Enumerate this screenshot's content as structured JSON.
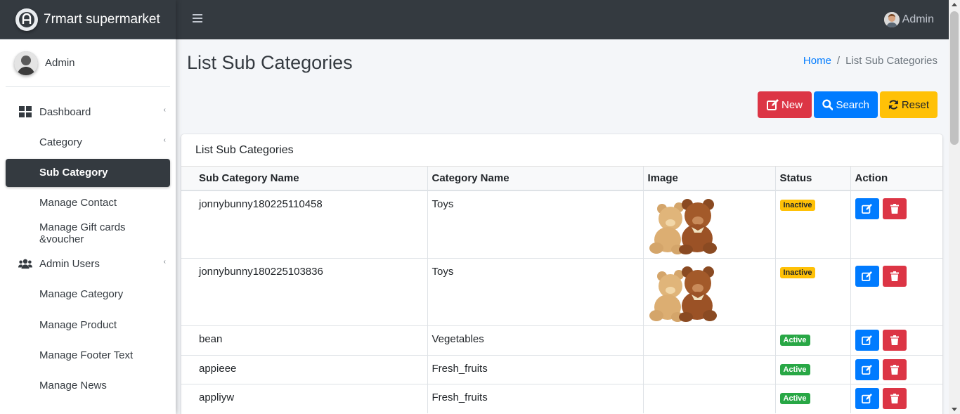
{
  "brand": {
    "name": "7rmart supermarket"
  },
  "sidebar": {
    "user_name": "Admin",
    "items": [
      {
        "label": "Dashboard",
        "icon": "dashboard-icon",
        "type": "top"
      },
      {
        "label": "Category",
        "type": "sub"
      },
      {
        "label": "Sub Category",
        "type": "sub",
        "active": true
      },
      {
        "label": "Manage Contact",
        "type": "sub"
      },
      {
        "label": "Manage Gift cards &voucher",
        "type": "sub"
      },
      {
        "label": "Admin Users",
        "icon": "users-icon",
        "type": "top"
      },
      {
        "label": "Manage Category",
        "type": "sub"
      },
      {
        "label": "Manage Product",
        "type": "sub"
      },
      {
        "label": "Manage Footer Text",
        "type": "sub"
      },
      {
        "label": "Manage News",
        "type": "sub"
      }
    ]
  },
  "topbar": {
    "user_name": "Admin"
  },
  "page": {
    "title": "List Sub Categories",
    "breadcrumb": {
      "home": "Home",
      "separator": "/",
      "current": "List Sub Categories"
    }
  },
  "toolbar": {
    "new_label": "New",
    "search_label": "Search",
    "reset_label": "Reset"
  },
  "card": {
    "title": "List Sub Categories",
    "columns": [
      "Sub Category Name",
      "Category Name",
      "Image",
      "Status",
      "Action"
    ],
    "rows": [
      {
        "sub_category": "jonnybunny180225110458",
        "category": "Toys",
        "image": "teddy-bears-image",
        "status": "Inactive"
      },
      {
        "sub_category": "jonnybunny180225103836",
        "category": "Toys",
        "image": "teddy-bears-image",
        "status": "Inactive"
      },
      {
        "sub_category": "bean",
        "category": "Vegetables",
        "image": "",
        "status": "Active"
      },
      {
        "sub_category": "appieee",
        "category": "Fresh_fruits",
        "image": "",
        "status": "Active"
      },
      {
        "sub_category": "appliyw",
        "category": "Fresh_fruits",
        "image": "",
        "status": "Active"
      }
    ]
  },
  "colors": {
    "navbar": "#343a40",
    "primary": "#007bff",
    "danger": "#dc3545",
    "warning": "#ffc107",
    "success": "#28a745"
  }
}
